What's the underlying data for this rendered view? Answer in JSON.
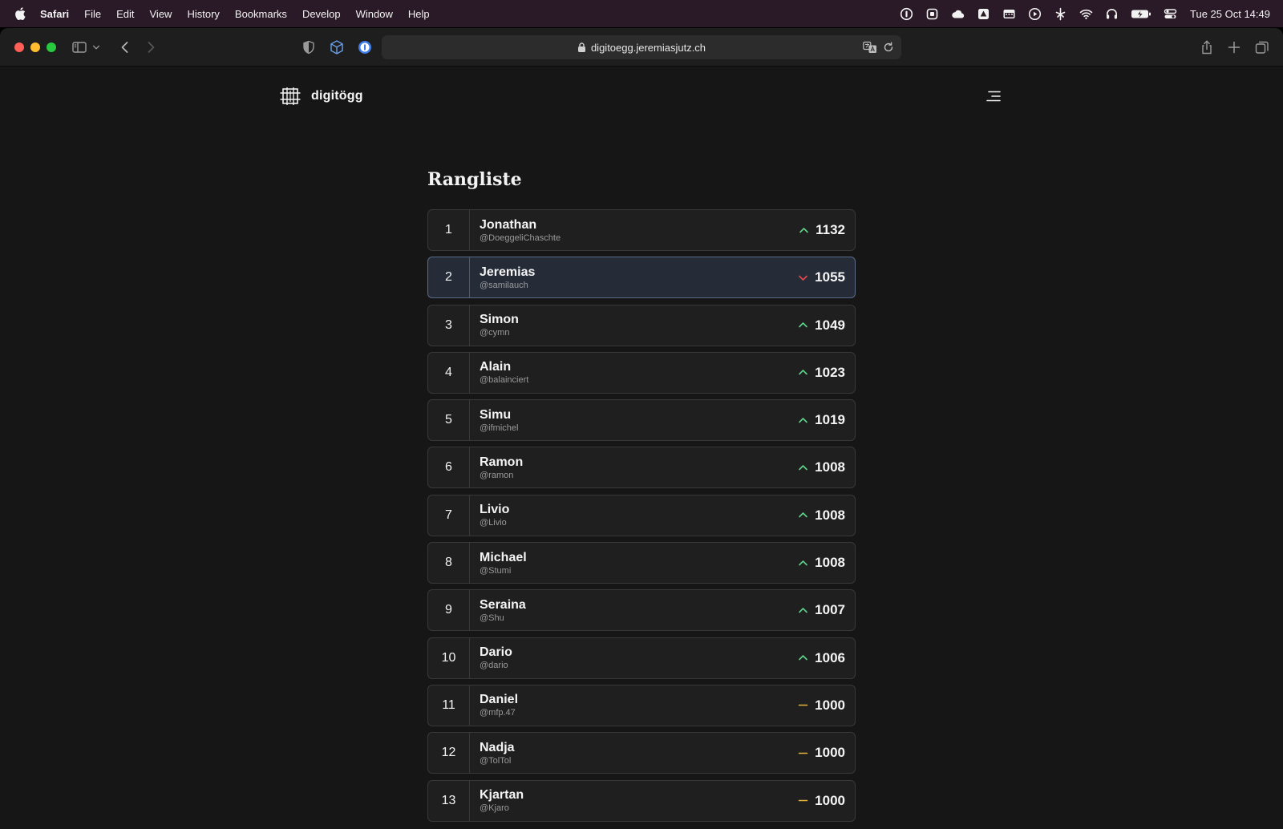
{
  "menubar": {
    "app": "Safari",
    "items": [
      "File",
      "Edit",
      "View",
      "History",
      "Bookmarks",
      "Develop",
      "Window",
      "Help"
    ],
    "status_icons": [
      "onepassword-icon",
      "stop-icon",
      "cloud-icon",
      "drive-icon",
      "calendar-icon",
      "play-icon",
      "fan-icon",
      "wifi-icon",
      "headphones-icon",
      "battery-icon",
      "control-center-icon"
    ],
    "clock": "Tue 25 Oct  14:49"
  },
  "browser": {
    "url": "digitoegg.jeremiasjutz.ch"
  },
  "site": {
    "brand": "digitögg"
  },
  "page": {
    "title": "Rangliste"
  },
  "ranking": [
    {
      "rank": "1",
      "name": "Jonathan",
      "handle": "@DoeggeliChaschte",
      "trend": "up",
      "score": "1132"
    },
    {
      "rank": "2",
      "name": "Jeremias",
      "handle": "@samilauch",
      "trend": "down",
      "score": "1055"
    },
    {
      "rank": "3",
      "name": "Simon",
      "handle": "@cymn",
      "trend": "up",
      "score": "1049"
    },
    {
      "rank": "4",
      "name": "Alain",
      "handle": "@balainciert",
      "trend": "up",
      "score": "1023"
    },
    {
      "rank": "5",
      "name": "Simu",
      "handle": "@ifmichel",
      "trend": "up",
      "score": "1019"
    },
    {
      "rank": "6",
      "name": "Ramon",
      "handle": "@ramon",
      "trend": "up",
      "score": "1008"
    },
    {
      "rank": "7",
      "name": "Livio",
      "handle": "@Livio",
      "trend": "up",
      "score": "1008"
    },
    {
      "rank": "8",
      "name": "Michael",
      "handle": "@Stumi",
      "trend": "up",
      "score": "1008"
    },
    {
      "rank": "9",
      "name": "Seraina",
      "handle": "@Shu",
      "trend": "up",
      "score": "1007"
    },
    {
      "rank": "10",
      "name": "Dario",
      "handle": "@dario",
      "trend": "up",
      "score": "1006"
    },
    {
      "rank": "11",
      "name": "Daniel",
      "handle": "@mfp.47",
      "trend": "neutral",
      "score": "1000"
    },
    {
      "rank": "12",
      "name": "Nadja",
      "handle": "@TolTol",
      "trend": "neutral",
      "score": "1000"
    },
    {
      "rank": "13",
      "name": "Kjartan",
      "handle": "@Kjaro",
      "trend": "neutral",
      "score": "1000"
    }
  ],
  "colors": {
    "trend_up": "#5fd38a",
    "trend_down": "#e5484d",
    "trend_neutral": "#e3b341",
    "active_row_border": "#5a6c87"
  }
}
